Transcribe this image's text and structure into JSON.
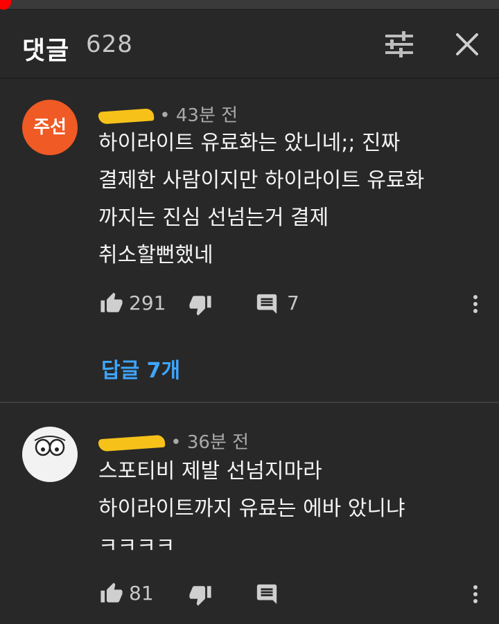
{
  "header": {
    "title": "댓글",
    "count": "628"
  },
  "comments": [
    {
      "avatar_text": "주선",
      "avatar_color": "#f05a24",
      "time": "43분 전",
      "body": "하이라이트 유료화는 았니네;; 진짜\n결제한 사람이지만 하이라이트 유료화\n까지는 진심 선넘는거 결제\n취소할뻔했네",
      "likes": "291",
      "reply_count": "7",
      "replies_link": "답글 7개"
    },
    {
      "avatar_text": "",
      "avatar_color": "#f2f2f2",
      "time": "36분 전",
      "body": "스포티비 제발 선넘지마라\n하이라이트까지 유료는 에바 았니냐\nㅋㅋㅋㅋ",
      "likes": "81",
      "reply_count": ""
    }
  ],
  "icons": {
    "filter": "sliders-icon",
    "close": "close-icon",
    "like": "thumbs-up-icon",
    "dislike": "thumbs-down-icon",
    "reply": "comment-icon",
    "more": "more-vert-icon"
  },
  "colors": {
    "background": "#282828",
    "link": "#3ea6ff",
    "progress": "#ff0000"
  }
}
